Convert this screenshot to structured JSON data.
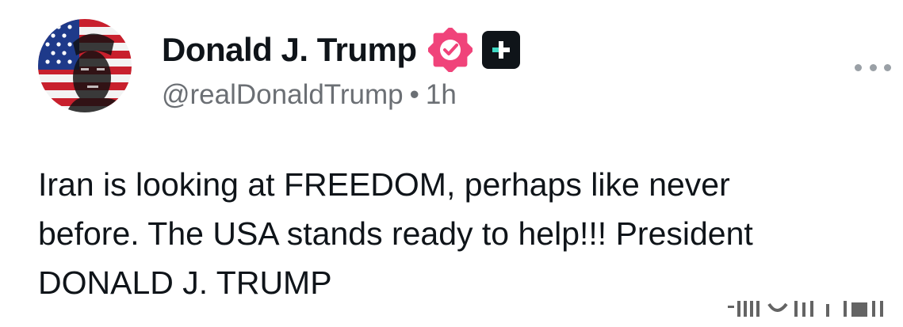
{
  "post": {
    "author": {
      "display_name": "Donald J. Trump",
      "handle": "@realDonaldTrump",
      "separator": "•",
      "time_ago": "1h",
      "verified_icon": "verified-badge-icon",
      "verified_color": "#f0437a",
      "plus_icon": "plus-badge-icon",
      "avatar_icon": "american-flag-portrait-avatar"
    },
    "more_icon": "more-dots-icon",
    "text_lines": [
      "Iran is looking at FREEDOM, perhaps like never",
      "before. The USA stands ready to help!!! President",
      "DONALD J. TRUMP"
    ]
  },
  "colors": {
    "text": "#0f1419",
    "muted": "#6b6f74",
    "accent": "#f0437a",
    "badge_bg": "#0f1419",
    "badge_mark": "#3fd9c4"
  }
}
